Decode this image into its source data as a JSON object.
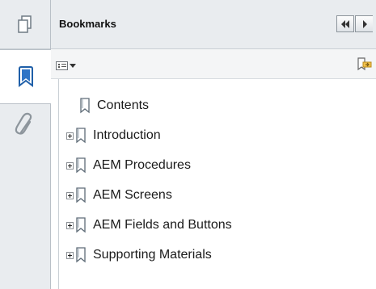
{
  "panel": {
    "title": "Bookmarks"
  },
  "rail": {
    "items": [
      {
        "icon": "page-thumbnails-icon",
        "active": false
      },
      {
        "icon": "bookmark-icon",
        "active": true
      },
      {
        "icon": "paperclip-icon",
        "active": false
      }
    ]
  },
  "toolbar": {
    "options_icon": "options-menu-icon",
    "new_bookmark_icon": "new-bookmark-icon"
  },
  "bookmarks": [
    {
      "label": "Contents",
      "expandable": false
    },
    {
      "label": "Introduction",
      "expandable": true
    },
    {
      "label": "AEM Procedures",
      "expandable": true
    },
    {
      "label": "AEM Screens",
      "expandable": true
    },
    {
      "label": "AEM Fields and Buttons",
      "expandable": true
    },
    {
      "label": "Supporting Materials",
      "expandable": true
    }
  ],
  "colors": {
    "panel_bg": "#e9ecef",
    "accent_blue": "#2e74c6"
  }
}
